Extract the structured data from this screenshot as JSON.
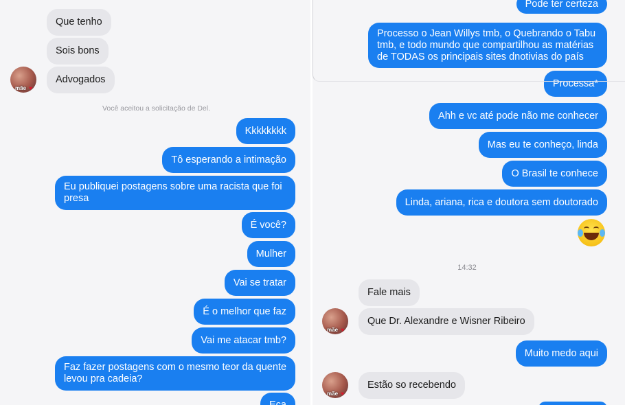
{
  "left_conversation": {
    "messages": [
      {
        "id": "l1",
        "direction": "in",
        "text": "Que tenho"
      },
      {
        "id": "l2",
        "direction": "in",
        "text": "Sois bons"
      },
      {
        "id": "l3",
        "direction": "in",
        "text": "Advogados"
      },
      {
        "id": "l4",
        "direction": "out",
        "text": "Kkkkkkkk"
      },
      {
        "id": "l5",
        "direction": "out",
        "text": "Tô esperando a intimação"
      },
      {
        "id": "l6",
        "direction": "out",
        "text": "Eu publiquei postagens sobre uma racista que foi presa"
      },
      {
        "id": "l7",
        "direction": "out",
        "text": "É você?"
      },
      {
        "id": "l8",
        "direction": "out",
        "text": "Mulher"
      },
      {
        "id": "l9",
        "direction": "out",
        "text": "Vai se tratar"
      },
      {
        "id": "l10",
        "direction": "out",
        "text": "É o melhor que faz"
      },
      {
        "id": "l11",
        "direction": "out",
        "text": "Vai me atacar tmb?"
      },
      {
        "id": "l12",
        "direction": "out",
        "text": "Faz fazer postagens com o mesmo teor da quente levou pra cadeia?"
      },
      {
        "id": "l13",
        "direction": "out",
        "text": "Eça"
      }
    ],
    "system_notice": "Você aceitou a solicitação de Del.",
    "avatar_label": "mãe",
    "avatar_heart": "♥"
  },
  "right_conversation": {
    "messages": [
      {
        "id": "r1",
        "direction": "out",
        "text": "Pode ter certeza"
      },
      {
        "id": "r2",
        "direction": "out",
        "text": "Processo o Jean Willys tmb, o Quebrando o Tabu tmb, e todo mundo que compartilhou as matérias de TODAS os principais sites dnotivias do país"
      },
      {
        "id": "r3",
        "direction": "out",
        "text": "Processa*"
      },
      {
        "id": "r4",
        "direction": "out",
        "text": "Ahh e vc até pode não me conhecer"
      },
      {
        "id": "r5",
        "direction": "out",
        "text": "Mas eu te conheço, linda"
      },
      {
        "id": "r6",
        "direction": "out",
        "text": "O Brasil te conhece"
      },
      {
        "id": "r7",
        "direction": "out",
        "text": "Linda, ariana, rica e doutora sem doutorado"
      },
      {
        "id": "r8",
        "direction": "in",
        "text": "Fale mais"
      },
      {
        "id": "r9",
        "direction": "in",
        "text": "Que Dr. Alexandre e Wisner Ribeiro"
      },
      {
        "id": "r10",
        "direction": "out",
        "text": "Muito medo aqui"
      },
      {
        "id": "r11",
        "direction": "in",
        "text": "Estão so recebendo"
      }
    ],
    "timestamp": "14:32",
    "emoji": "grinning-squinting-face-with-tears",
    "avatar_label": "mãe",
    "avatar_heart": "♥"
  },
  "colors": {
    "outgoing_bubble": "#1a7ff0",
    "incoming_bubble": "#e6e6ea",
    "background": "#f5f5f7"
  }
}
